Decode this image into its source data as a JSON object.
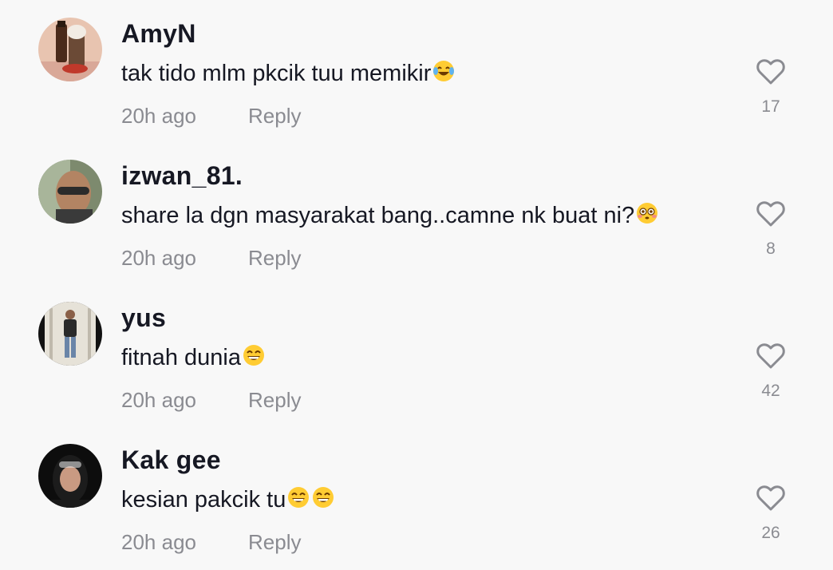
{
  "comments": [
    {
      "username": "AmyN",
      "text": "tak tido mlm pkcik tuu memikir",
      "emojis": [
        "face-with-tears-of-joy"
      ],
      "time": "20h ago",
      "reply_label": "Reply",
      "like_count": "17",
      "avatar": "avatar-photo-drinks"
    },
    {
      "username": "izwan_81.",
      "text": "share la dgn masyarakat bang..camne nk buat ni?",
      "emojis": [
        "flushed-face"
      ],
      "time": "20h ago",
      "reply_label": "Reply",
      "like_count": "8",
      "avatar": "avatar-photo-man-sunglasses"
    },
    {
      "username": "yus",
      "text": "fitnah dunia",
      "emojis": [
        "grinning-face-with-smiling-eyes"
      ],
      "time": "20h ago",
      "reply_label": "Reply",
      "like_count": "42",
      "avatar": "avatar-photo-standing-man"
    },
    {
      "username": "Kak gee",
      "text": "kesian pakcik tu",
      "emojis": [
        "grinning-face-with-smiling-eyes",
        "grinning-face-with-smiling-eyes"
      ],
      "time": "20h ago",
      "reply_label": "Reply",
      "like_count": "26",
      "avatar": "avatar-photo-woman-hijab"
    }
  ],
  "colors": {
    "background": "#f8f8f8",
    "username": "#161823",
    "secondary_text": "#8a8b91",
    "heart_outline": "#8a8b91"
  }
}
